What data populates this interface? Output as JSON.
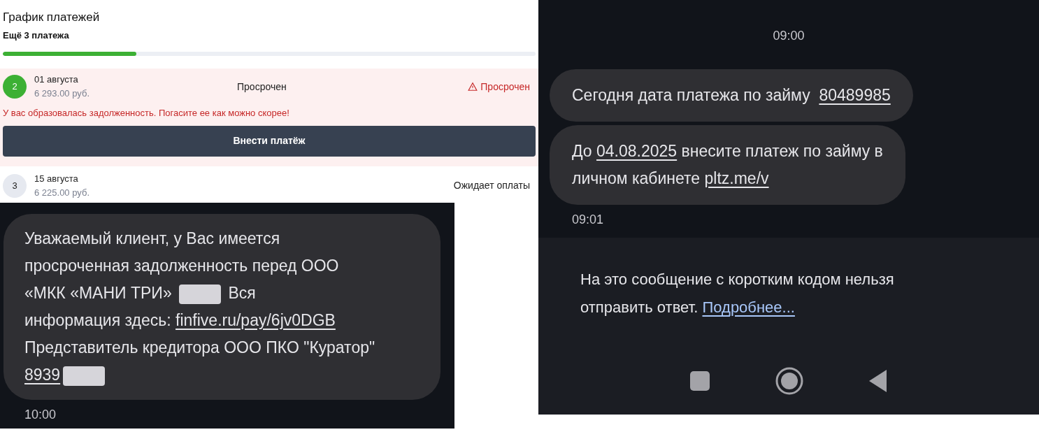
{
  "payment_schedule": {
    "title": "График платежей",
    "subtitle": "Ещё 3 платежа",
    "progress": {
      "level": 0.25
    },
    "payments": [
      {
        "number": "2",
        "date": "01 августа",
        "amount": "6 293.00 руб.",
        "status": "Просрочен",
        "overdue": true,
        "alert": "Просрочен",
        "warning": "У вас образовалась задолженность. Погасите ее как можно скорее!",
        "button": "Внести платёж"
      },
      {
        "number": "3",
        "date": "15 августа",
        "amount": "6 225.00 руб.",
        "status": "Ожидает оплаты",
        "overdue": false
      }
    ]
  },
  "sms_left": {
    "lines": [
      [
        {
          "kind": "text",
          "text": "Уважаемый клиент, у Вас имеется"
        }
      ],
      [
        {
          "kind": "text",
          "text": "просроченная задолженность перед ООО"
        }
      ],
      [
        {
          "kind": "text",
          "text": "«МКК «МАНИ ТРИ» "
        },
        {
          "kind": "redacted"
        },
        {
          "kind": "text",
          "text": " Вся"
        }
      ],
      [
        {
          "kind": "text",
          "text": "информация здесь: "
        },
        {
          "kind": "link",
          "text": "finfive.ru/pay/6jv0DGB"
        }
      ],
      [
        {
          "kind": "text",
          "text": "Представитель кредитора ООО ПКО \"Куратор\""
        }
      ],
      [
        {
          "kind": "link",
          "text": "8939"
        },
        {
          "kind": "redacted"
        }
      ]
    ],
    "time": "10:00"
  },
  "sms_right": {
    "header_time": "09:00",
    "messages": [
      {
        "lines": [
          [
            {
              "kind": "text",
              "text": "Сегодня дата платежа по займу  "
            },
            {
              "kind": "link",
              "text": "80489985"
            }
          ]
        ]
      },
      {
        "lines": [
          [
            {
              "kind": "text",
              "text": "До "
            },
            {
              "kind": "link",
              "text": "04.08.2025"
            },
            {
              "kind": "text",
              "text": " внесите платеж по займу в"
            }
          ],
          [
            {
              "kind": "text",
              "text": "личном кабинете "
            },
            {
              "kind": "link",
              "text": "pltz.me/v"
            }
          ]
        ]
      }
    ],
    "time": "09:01",
    "notice": {
      "lines": [
        [
          {
            "kind": "text",
            "text": "На это сообщение с коротким кодом нельзя"
          }
        ],
        [
          {
            "kind": "text",
            "text": "отправить ответ. "
          },
          {
            "kind": "info_link",
            "text": "Подробнее..."
          }
        ]
      ]
    }
  }
}
